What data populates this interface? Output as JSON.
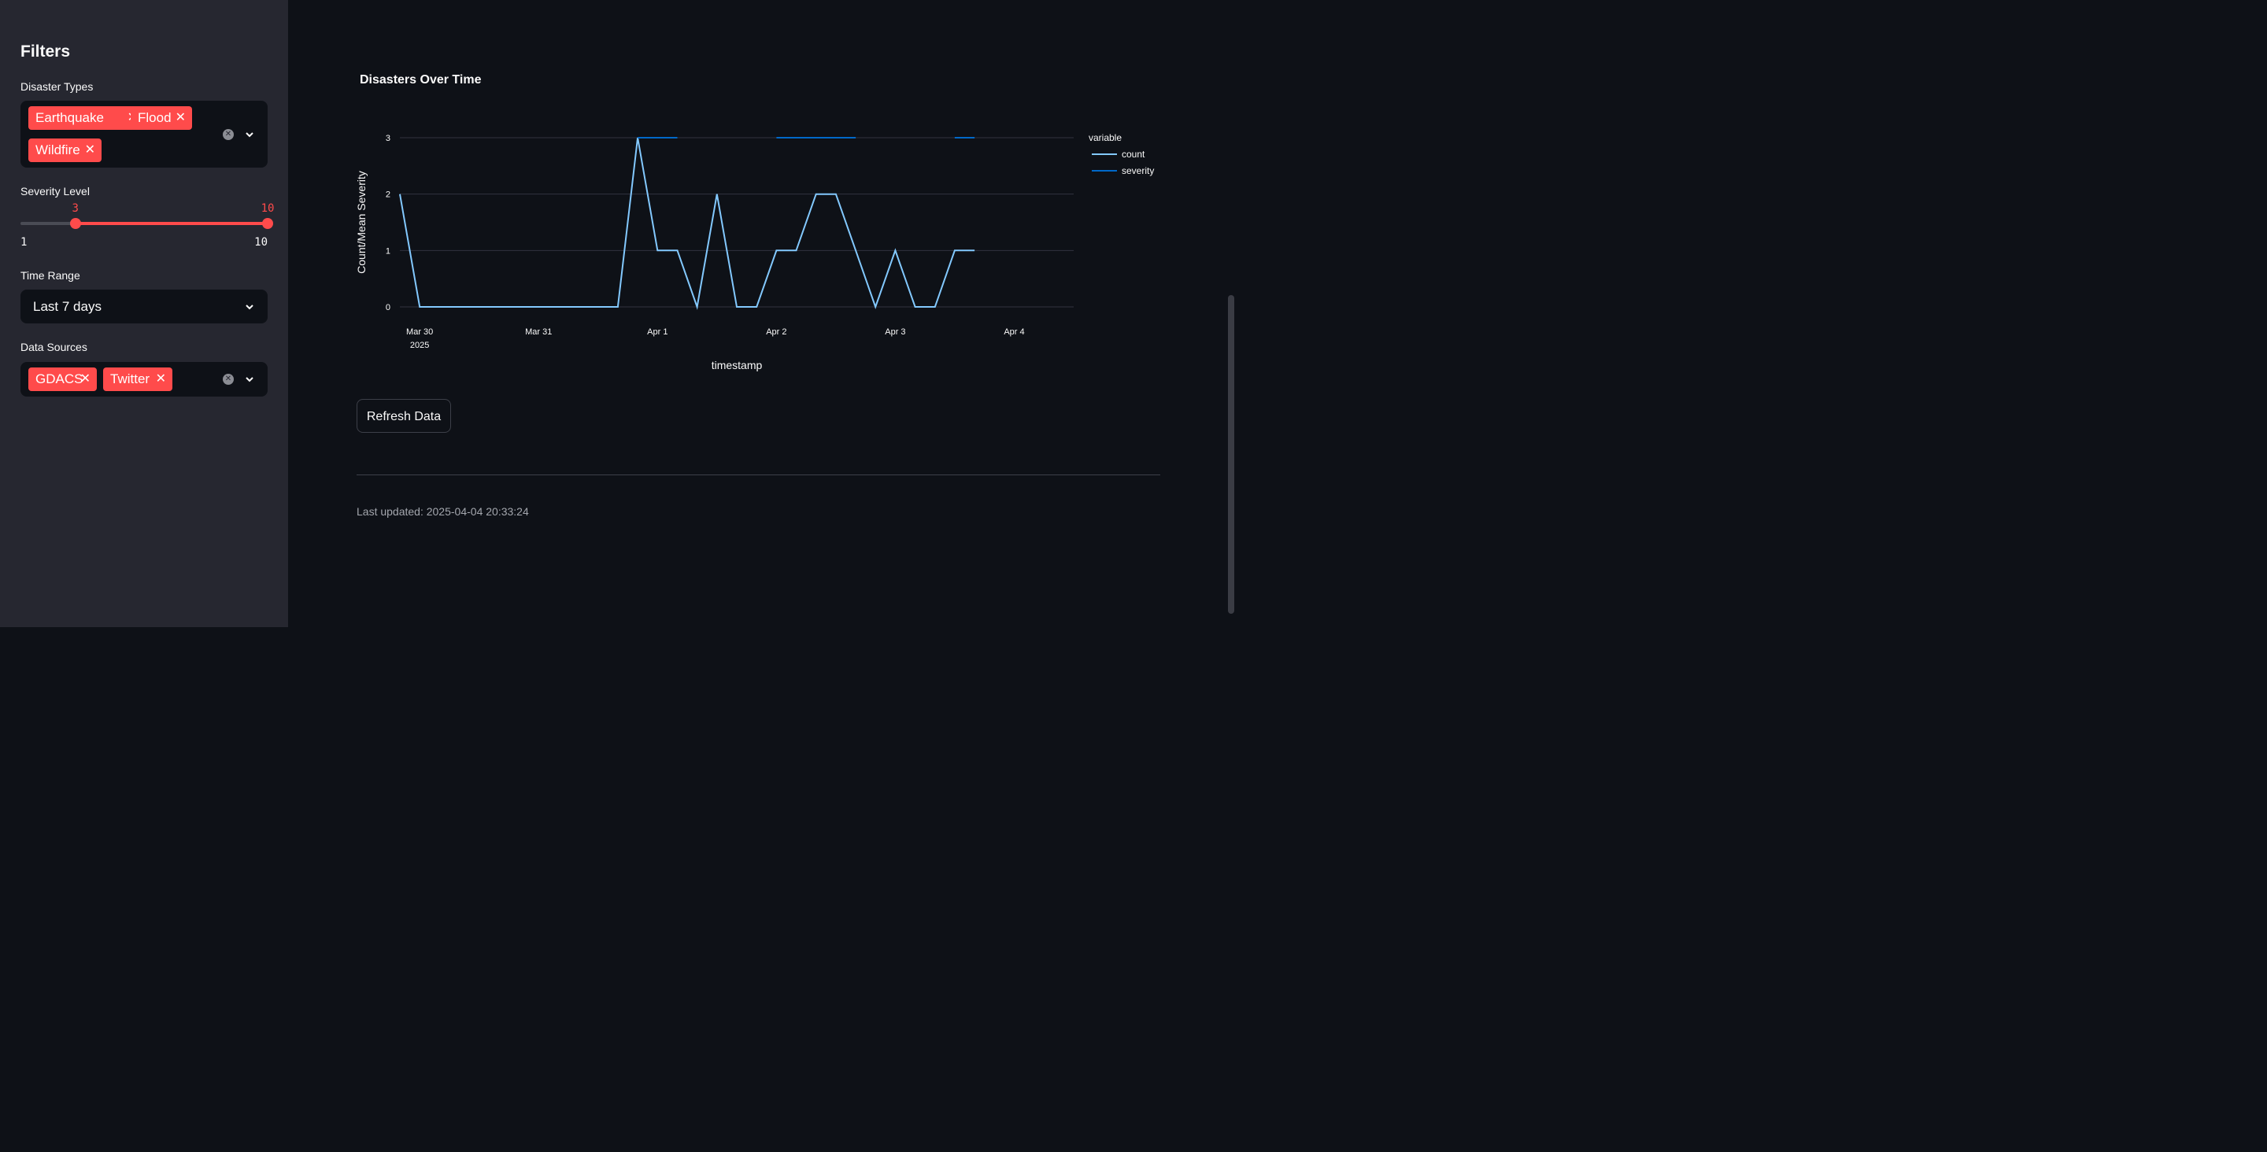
{
  "sidebar": {
    "title": "Filters",
    "disaster_types": {
      "label": "Disaster Types",
      "tags": [
        "Earthquake",
        "Flood",
        "Wildfire"
      ]
    },
    "severity": {
      "label": "Severity Level",
      "min": "1",
      "max": "10",
      "low_value": "3",
      "high_value": "10",
      "low_fraction": 0.222,
      "high_fraction": 1.0
    },
    "time_range": {
      "label": "Time Range",
      "selected": "Last 7 days"
    },
    "data_sources": {
      "label": "Data Sources",
      "tags": [
        "GDACS",
        "Twitter"
      ]
    }
  },
  "main": {
    "refresh_label": "Refresh Data",
    "last_updated": "Last updated: 2025-04-04 20:33:24"
  },
  "colors": {
    "accent": "#ff4b4b",
    "count_line": "#83c9ff",
    "severity_line": "#0068c9",
    "background": "#0e1117",
    "sidebar": "#262730"
  },
  "chart_data": {
    "type": "line",
    "title": "Disasters Over Time",
    "xlabel": "timestamp",
    "ylabel": "Count/Mean Severity",
    "ylim": [
      0,
      3
    ],
    "yticks": [
      "0",
      "1",
      "2",
      "3"
    ],
    "xticks": [
      {
        "date": "2025-03-30 00:00",
        "label": "Mar 30",
        "sublabel": "2025"
      },
      {
        "date": "2025-03-31 00:00",
        "label": "Mar 31",
        "sublabel": ""
      },
      {
        "date": "2025-04-01 00:00",
        "label": "Apr 1",
        "sublabel": ""
      },
      {
        "date": "2025-04-02 00:00",
        "label": "Apr 2",
        "sublabel": ""
      },
      {
        "date": "2025-04-03 00:00",
        "label": "Apr 3",
        "sublabel": ""
      },
      {
        "date": "2025-04-04 00:00",
        "label": "Apr 4",
        "sublabel": ""
      }
    ],
    "x": [
      "2025-03-29 20:00",
      "2025-03-30 00:00",
      "2025-03-30 04:00",
      "2025-03-30 08:00",
      "2025-03-30 12:00",
      "2025-03-30 16:00",
      "2025-03-30 20:00",
      "2025-03-31 00:00",
      "2025-03-31 04:00",
      "2025-03-31 08:00",
      "2025-03-31 12:00",
      "2025-03-31 16:00",
      "2025-03-31 20:00",
      "2025-04-01 00:00",
      "2025-04-01 04:00",
      "2025-04-01 08:00",
      "2025-04-01 12:00",
      "2025-04-01 16:00",
      "2025-04-01 20:00",
      "2025-04-02 00:00",
      "2025-04-02 04:00",
      "2025-04-02 08:00",
      "2025-04-02 12:00",
      "2025-04-02 16:00",
      "2025-04-02 20:00",
      "2025-04-03 00:00",
      "2025-04-03 04:00",
      "2025-04-03 08:00",
      "2025-04-03 12:00",
      "2025-04-03 16:00",
      "2025-04-03 20:00",
      "2025-04-04 00:00",
      "2025-04-04 04:00",
      "2025-04-04 08:00",
      "2025-04-04 12:00"
    ],
    "series": [
      {
        "name": "count",
        "values": [
          2,
          0,
          0,
          0,
          0,
          0,
          0,
          0,
          0,
          0,
          0,
          0,
          3,
          1,
          1,
          0,
          2,
          0,
          0,
          1,
          1,
          2,
          2,
          1,
          0,
          1,
          0,
          0,
          1,
          1,
          null,
          null,
          null,
          null,
          null
        ]
      },
      {
        "name": "severity",
        "values": [
          null,
          null,
          null,
          null,
          null,
          null,
          null,
          null,
          null,
          null,
          null,
          null,
          3,
          3,
          3,
          null,
          null,
          null,
          null,
          3,
          3,
          3,
          3,
          3,
          null,
          null,
          null,
          null,
          3,
          3,
          null,
          null,
          null,
          null,
          null
        ]
      }
    ],
    "legend_title": "variable",
    "legend_position": "top-right",
    "grid": true
  }
}
